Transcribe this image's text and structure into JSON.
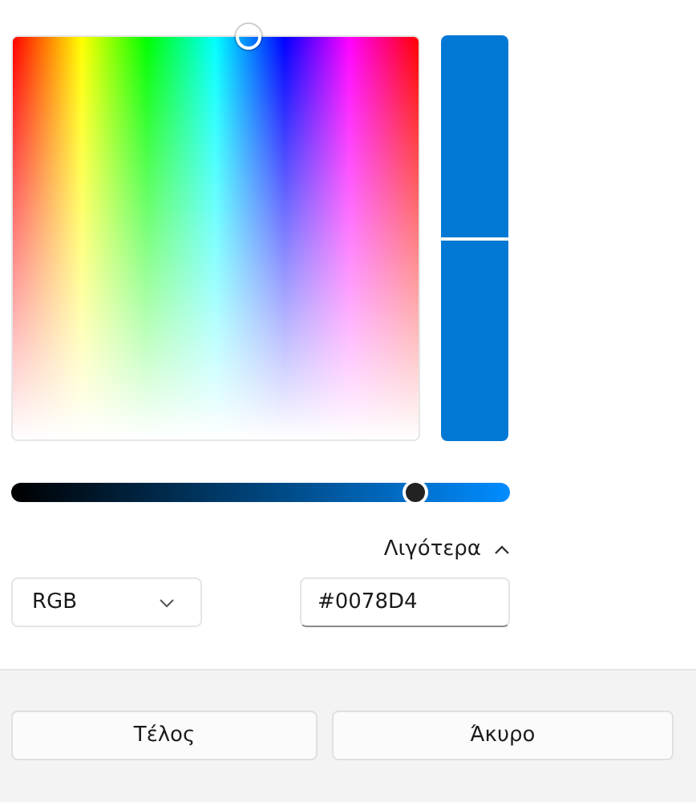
{
  "previews": [
    {
      "color": "#0078d4"
    },
    {
      "color": "#0078d4"
    }
  ],
  "value_slider": {
    "level": 0.81
  },
  "toggle": {
    "label": "Λιγότερα",
    "expanded": true
  },
  "mode_dropdown": {
    "value": "RGB"
  },
  "hex_field": {
    "value": "#0078D4"
  },
  "buttons": [
    "Τέλος",
    "Άκυρο"
  ]
}
